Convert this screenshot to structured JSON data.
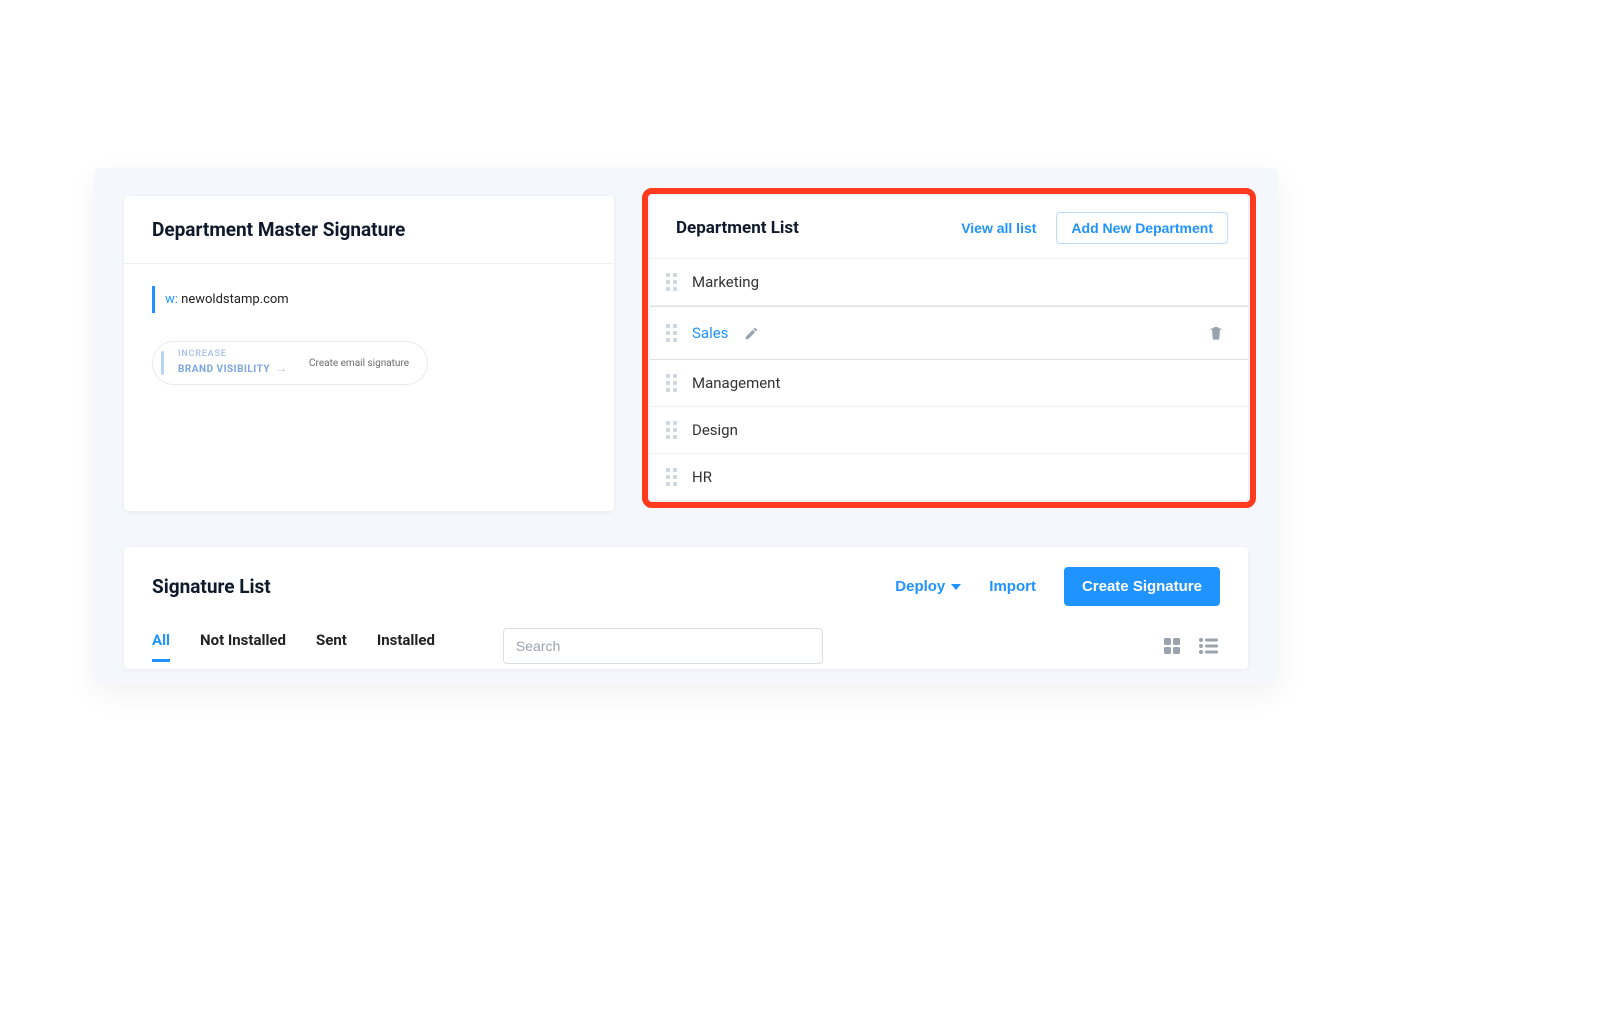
{
  "master": {
    "title": "Department Master Signature",
    "w_prefix": "w:",
    "website": "newoldstamp.com",
    "banner_line1": "INCREASE",
    "banner_line2": "BRAND VISIBILITY",
    "banner_cta": "Create email signature"
  },
  "departments": {
    "title": "Department List",
    "view_all_label": "View all list",
    "add_label": "Add New Department",
    "items": [
      {
        "name": "Marketing",
        "selected": false
      },
      {
        "name": "Sales",
        "selected": true
      },
      {
        "name": "Management",
        "selected": false
      },
      {
        "name": "Design",
        "selected": false
      },
      {
        "name": "HR",
        "selected": false
      }
    ]
  },
  "siglist": {
    "title": "Signature List",
    "deploy_label": "Deploy",
    "import_label": "Import",
    "create_label": "Create Signature",
    "tabs": [
      "All",
      "Not Installed",
      "Sent",
      "Installed"
    ],
    "active_tab": "All",
    "search_placeholder": "Search"
  }
}
